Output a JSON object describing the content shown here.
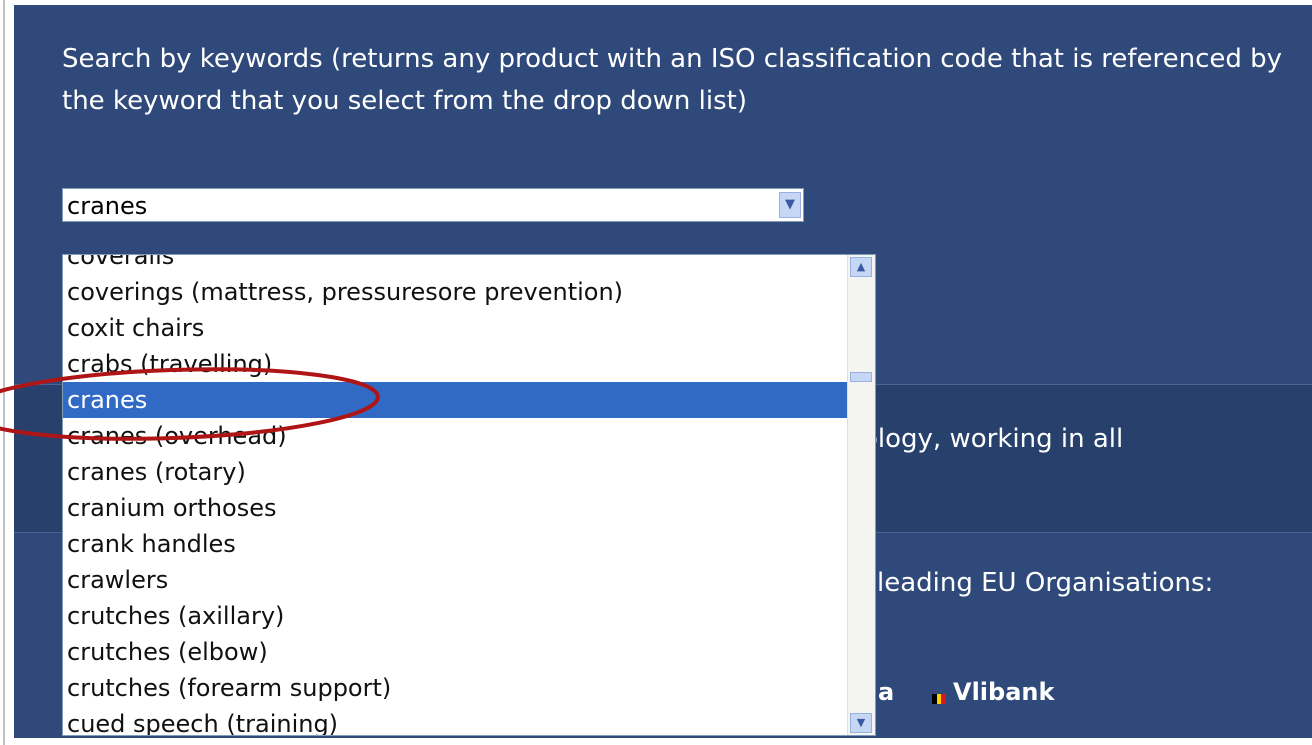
{
  "intro": {
    "text": "Search by keywords (returns any product with an ISO classification code that is referenced by the keyword that you select from the drop down list)"
  },
  "keyword_select": {
    "value": "cranes",
    "arrow_icon": "chevron-down-icon"
  },
  "keyword_list": {
    "items": [
      "coveralls",
      "coverings (mattress, pressuresore prevention)",
      "coxit chairs",
      "crabs (travelling)",
      "cranes",
      "cranes (overhead)",
      "cranes (rotary)",
      "cranium orthoses",
      "crank handles",
      "crawlers",
      "crutches (axillary)",
      "crutches (elbow)",
      "crutches (forearm support)",
      "cued speech (training)"
    ],
    "selected": "cranes",
    "selection_color": "#316ac5"
  },
  "background": {
    "line1_fragment": "ology, working in all",
    "line2_fragment": "leading EU Organisations:",
    "partial_org": "a",
    "org_name": "Vlibank",
    "org_flag_colors": [
      "#000000",
      "#f5d300",
      "#d8161b"
    ]
  },
  "annotation": {
    "ellipse_color": "#b01515"
  },
  "colors": {
    "panel_bg": "#2f4a7a",
    "band_bg": "#27406c"
  }
}
